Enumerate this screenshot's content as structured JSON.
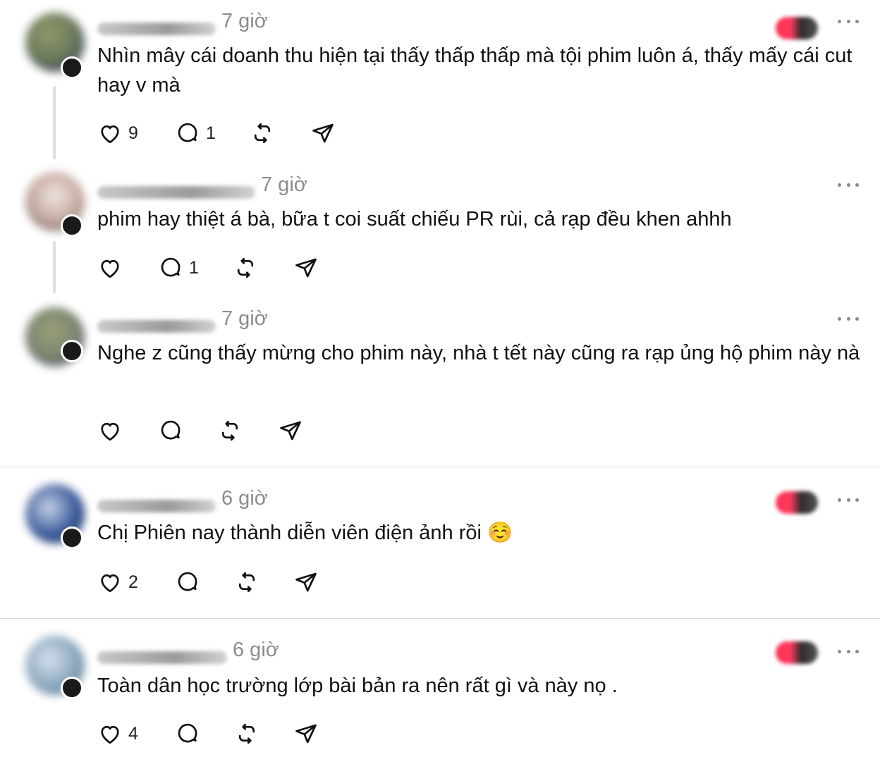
{
  "posts": [
    {
      "time": "7 giờ",
      "text": "Nhìn mây cái doanh thu hiện tại thấy thấp thấp mà tội phim luôn á, thấy mấy cái cut hay v mà",
      "likes": "9",
      "replies": "1"
    },
    {
      "time": "7 giờ",
      "text": "phim hay thiệt á bà, bữa t coi suất chiếu PR rùi, cả rạp đều khen ahhh",
      "likes": "",
      "replies": "1"
    },
    {
      "time": "7 giờ",
      "text": "Nghe z cũng thấy mừng cho phim này, nhà t tết này cũng ra rạp ủng hộ phim này nà",
      "likes": "",
      "replies": ""
    },
    {
      "time": "6 giờ",
      "text": "Chị Phiên nay thành diễn viên điện ảnh rồi ☺️",
      "likes": "2",
      "replies": ""
    },
    {
      "time": "6 giờ",
      "text": "Toàn dân học trường lớp bài bản ra nên rất gì và này nọ .",
      "likes": "4",
      "replies": ""
    }
  ],
  "icons": {
    "like": "heart-icon",
    "reply": "comment-icon",
    "repost": "repost-icon",
    "share": "send-icon",
    "more": "more-options-icon"
  },
  "colors": {
    "text": "#111111",
    "muted": "#8c8c8c",
    "divider": "#d9d9d9"
  }
}
